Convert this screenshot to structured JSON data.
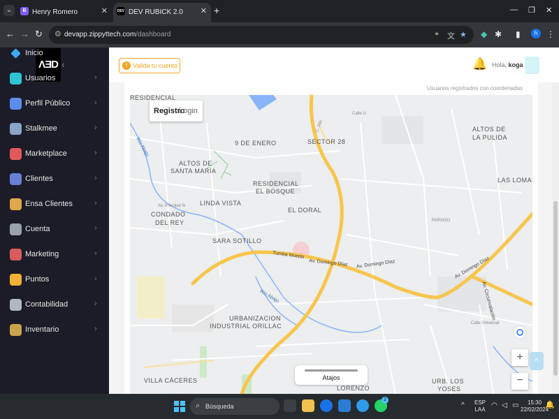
{
  "browser": {
    "tabs": [
      {
        "label": "Henry Romero",
        "favicon": "B"
      },
      {
        "label": "DEV RUBICK 2.0",
        "favicon": "DEV"
      }
    ],
    "url_host": "devapp.zippyttech.com",
    "url_path": "/dashboard",
    "profile_initial": "h"
  },
  "sidebar": {
    "logo": "ΛƎD",
    "items": [
      {
        "label": "Inicio",
        "icon": "diamond-icon",
        "color": "#3da9fc"
      },
      {
        "label": "Usuarios",
        "icon": "user-circle-icon",
        "color": "#2ec4d6"
      },
      {
        "label": "Perfil Público",
        "icon": "profile-icon",
        "color": "#5b8def"
      },
      {
        "label": "Stalkmee",
        "icon": "phone-icon",
        "color": "#8aa4c8"
      },
      {
        "label": "Marketplace",
        "icon": "store-icon",
        "color": "#e05a5a"
      },
      {
        "label": "Clientes",
        "icon": "clients-icon",
        "color": "#6b7fd7"
      },
      {
        "label": "Ensa Clientes",
        "icon": "person-badge-icon",
        "color": "#e0a84a"
      },
      {
        "label": "Cuenta",
        "icon": "ledger-icon",
        "color": "#9aa1ad"
      },
      {
        "label": "Marketing",
        "icon": "clipboard-icon",
        "color": "#d85c5c"
      },
      {
        "label": "Puntos",
        "icon": "medal-icon",
        "color": "#f2b134"
      },
      {
        "label": "Contabilidad",
        "icon": "building-icon",
        "color": "#b0b7c3"
      },
      {
        "label": "Inventario",
        "icon": "stack-icon",
        "color": "#c9a44a"
      }
    ]
  },
  "topbar": {
    "validate_label": "Valida tu cuenta",
    "greeting": "Hola,",
    "username": "koga"
  },
  "map": {
    "caption": "Usuarios registrados con coordenadas",
    "type_options": [
      "Registro",
      "Login"
    ],
    "shortcuts_label": "Atajos",
    "zoom_in": "+",
    "zoom_out": "−",
    "neighborhoods": [
      "RESIDENCIAL",
      "9 DE ENERO",
      "SECTOR 28",
      "ALTOS DE",
      "LA PULIDA",
      "ALTOS DE",
      "SANTA MARÍA",
      "LAS LOMAS",
      "RESIDENCIAL",
      "EL BOSQUE",
      "LINDA VISTA",
      "EL DORAL",
      "CONDADO",
      "DEL REY",
      "SARA SOTILLO",
      "PARAISO",
      "URBANIZACION",
      "INDUSTRIAL ORILLAC",
      "VILLA CÁCERES",
      "LORENZO",
      "URB. LOS",
      "YOSES"
    ],
    "roads": [
      "Tumba Muerto",
      "Av. Domingo Díaz",
      "Av. Domingo Díaz",
      "Av. Domingo Díaz",
      "Av. Circunvalación",
      "Calle U",
      "C. 2da",
      "Av. Principal N",
      "Calle Universal"
    ],
    "rivers": [
      "Río Abajo",
      "Río Abajo"
    ]
  },
  "taskbar": {
    "search_label": "Búsqueda",
    "lang_top": "ESP",
    "lang_bottom": "LAA",
    "time": "15:30",
    "date": "22/02/2024",
    "whatsapp_badge": "2"
  }
}
